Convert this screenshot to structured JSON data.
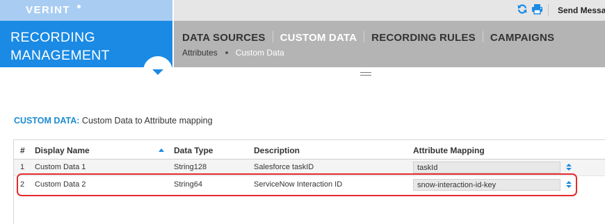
{
  "brand": {
    "logo": "VERINT",
    "app_title_line1": "RECORDING",
    "app_title_line2": "MANAGEMENT"
  },
  "topbar": {
    "send_message": "Send Messa",
    "icons": [
      "refresh-icon",
      "print-icon"
    ]
  },
  "nav": {
    "tabs": [
      {
        "label": "DATA SOURCES",
        "active": false
      },
      {
        "label": "CUSTOM DATA",
        "active": true
      },
      {
        "label": "RECORDING RULES",
        "active": false
      },
      {
        "label": "CAMPAIGNS",
        "active": false
      }
    ],
    "breadcrumb": {
      "parent": "Attributes",
      "current": "Custom Data"
    }
  },
  "section": {
    "label": "CUSTOM DATA:",
    "description": "Custom Data to Attribute mapping"
  },
  "table": {
    "columns": [
      "#",
      "Display Name",
      "Data Type",
      "Description",
      "Attribute Mapping"
    ],
    "sorted_column": "Display Name",
    "sort_direction": "ascending",
    "rows": [
      {
        "num": "1",
        "display_name": "Custom Data 1",
        "data_type": "String128",
        "description": "Salesforce taskID",
        "mapping": "taskId"
      },
      {
        "num": "2",
        "display_name": "Custom Data 2",
        "data_type": "String64",
        "description": "ServiceNow Interaction ID",
        "mapping": "snow-interaction-id-key"
      }
    ]
  },
  "colors": {
    "brand_blue": "#1a8ae4",
    "brand_light": "#a9cdf2",
    "nav_gray": "#b4b4b4",
    "section_label": "#1c8bcf",
    "highlight_red": "#e5292d"
  }
}
